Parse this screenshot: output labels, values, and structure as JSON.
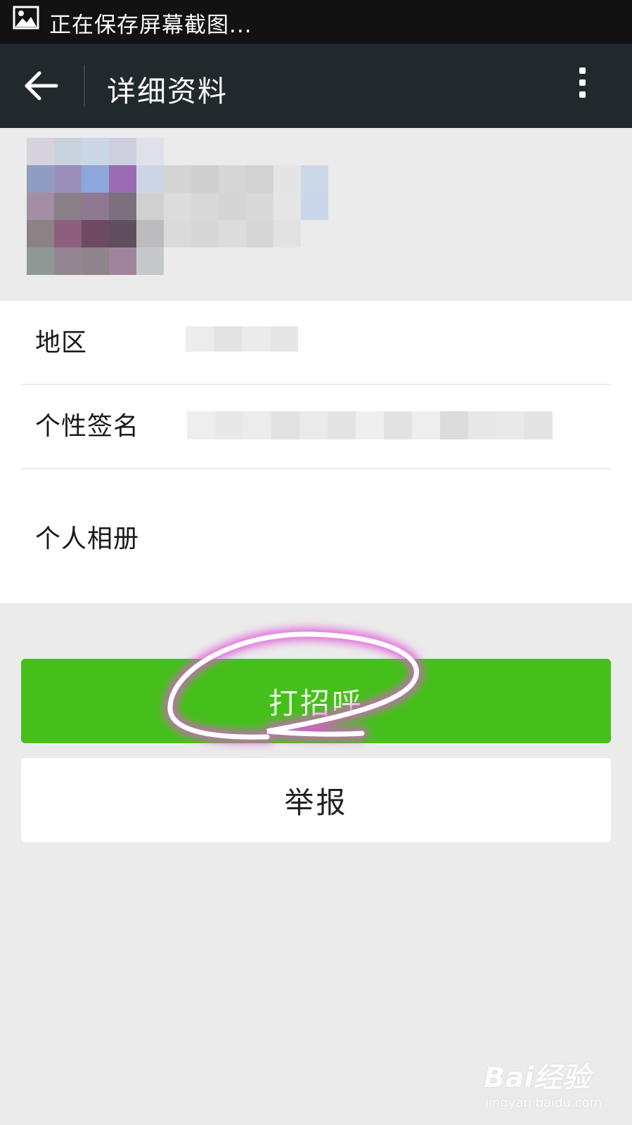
{
  "status_bar": {
    "icon": "image-icon",
    "text": "正在保存屏幕截图..."
  },
  "app_bar": {
    "back_icon": "back-arrow-icon",
    "title": "详细资料",
    "more_icon": "more-vertical-icon"
  },
  "profile": {
    "avatar": "blurred-avatar"
  },
  "info": {
    "rows": [
      {
        "label": "地区"
      },
      {
        "label": "个性签名"
      },
      {
        "label": "个人相册"
      }
    ]
  },
  "actions": {
    "greet_label": "打招呼",
    "report_label": "举报"
  },
  "colors": {
    "status_bar": "#121212",
    "app_bar": "#22292d",
    "background": "#ebebeb",
    "green_button": "#45c01a",
    "annotation": "#f0a0f0"
  },
  "watermark": {
    "logo": "Bai经验",
    "url": "jingyan.baidu.com"
  }
}
